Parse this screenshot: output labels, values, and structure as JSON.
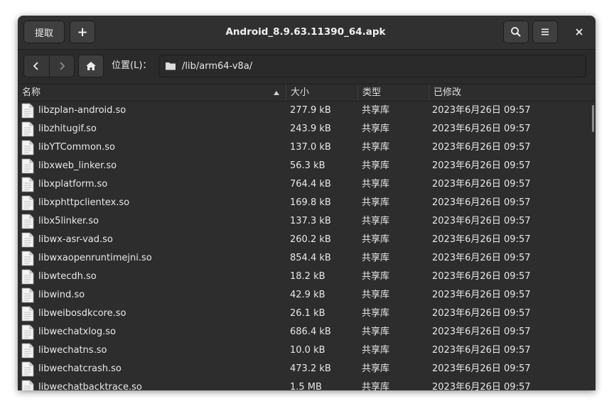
{
  "window": {
    "title": "Android_8.9.63.11390_64.apk"
  },
  "header": {
    "extract_label": "提取",
    "add_label": "+"
  },
  "location": {
    "label": "位置(L)：",
    "path": "/lib/arm64-v8a/"
  },
  "columns": {
    "name": "名称",
    "size": "大小",
    "type": "类型",
    "modified": "已修改"
  },
  "files": [
    {
      "name": "libzplan-android.so",
      "size": "277.9 kB",
      "type": "共享库",
      "modified": "2023年6月26日 09:57"
    },
    {
      "name": "libzhitugif.so",
      "size": "243.9 kB",
      "type": "共享库",
      "modified": "2023年6月26日 09:57"
    },
    {
      "name": "libYTCommon.so",
      "size": "137.0 kB",
      "type": "共享库",
      "modified": "2023年6月26日 09:57"
    },
    {
      "name": "libxweb_linker.so",
      "size": "56.3 kB",
      "type": "共享库",
      "modified": "2023年6月26日 09:57"
    },
    {
      "name": "libxplatform.so",
      "size": "764.4 kB",
      "type": "共享库",
      "modified": "2023年6月26日 09:57"
    },
    {
      "name": "libxphttpclientex.so",
      "size": "169.8 kB",
      "type": "共享库",
      "modified": "2023年6月26日 09:57"
    },
    {
      "name": "libx5linker.so",
      "size": "137.3 kB",
      "type": "共享库",
      "modified": "2023年6月26日 09:57"
    },
    {
      "name": "libwx-asr-vad.so",
      "size": "260.2 kB",
      "type": "共享库",
      "modified": "2023年6月26日 09:57"
    },
    {
      "name": "libwxaopenruntimejni.so",
      "size": "854.4 kB",
      "type": "共享库",
      "modified": "2023年6月26日 09:57"
    },
    {
      "name": "libwtecdh.so",
      "size": "18.2 kB",
      "type": "共享库",
      "modified": "2023年6月26日 09:57"
    },
    {
      "name": "libwind.so",
      "size": "42.9 kB",
      "type": "共享库",
      "modified": "2023年6月26日 09:57"
    },
    {
      "name": "libweibosdkcore.so",
      "size": "26.1 kB",
      "type": "共享库",
      "modified": "2023年6月26日 09:57"
    },
    {
      "name": "libwechatxlog.so",
      "size": "686.4 kB",
      "type": "共享库",
      "modified": "2023年6月26日 09:57"
    },
    {
      "name": "libwechatns.so",
      "size": "10.0 kB",
      "type": "共享库",
      "modified": "2023年6月26日 09:57"
    },
    {
      "name": "libwechatcrash.so",
      "size": "473.2 kB",
      "type": "共享库",
      "modified": "2023年6月26日 09:57"
    },
    {
      "name": "libwechatbacktrace.so",
      "size": "1.5 MB",
      "type": "共享库",
      "modified": "2023年6月26日 09:57"
    }
  ]
}
